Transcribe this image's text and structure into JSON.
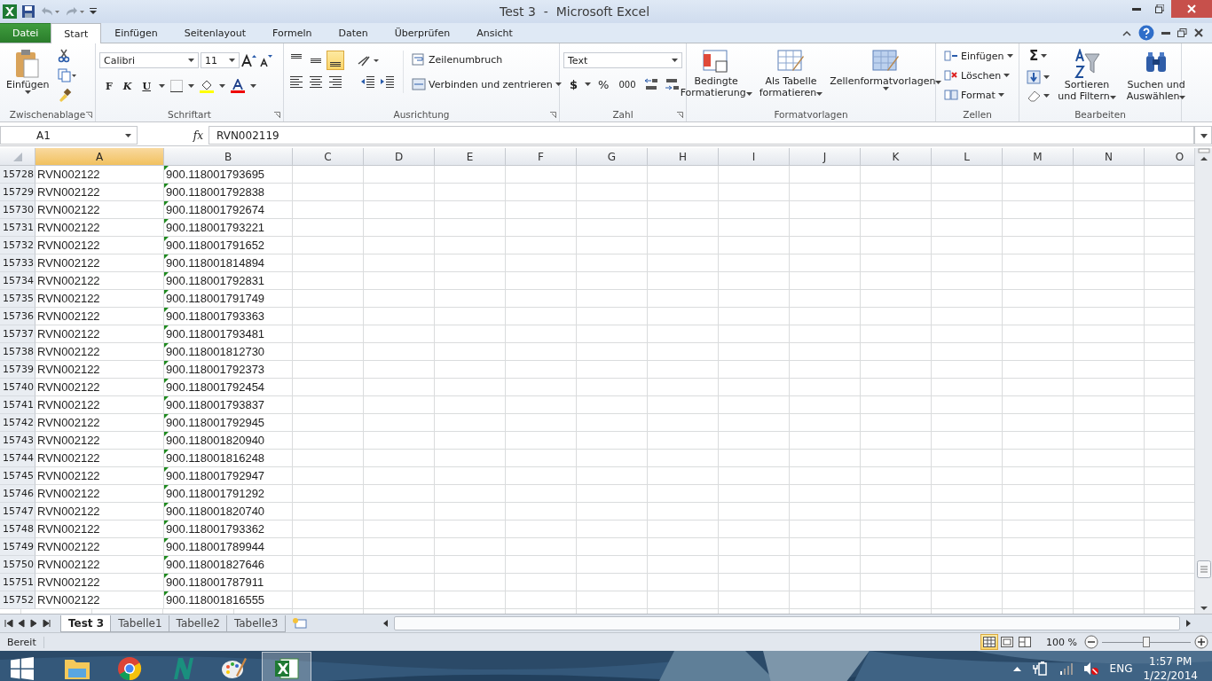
{
  "window": {
    "title": "Test 3  -  Microsoft Excel"
  },
  "tabs": [
    {
      "label": "Datei",
      "kind": "file",
      "selected": false
    },
    {
      "label": "Start",
      "kind": "tab",
      "selected": true
    },
    {
      "label": "Einfügen",
      "kind": "tab",
      "selected": false
    },
    {
      "label": "Seitenlayout",
      "kind": "tab",
      "selected": false
    },
    {
      "label": "Formeln",
      "kind": "tab",
      "selected": false
    },
    {
      "label": "Daten",
      "kind": "tab",
      "selected": false
    },
    {
      "label": "Überprüfen",
      "kind": "tab",
      "selected": false
    },
    {
      "label": "Ansicht",
      "kind": "tab",
      "selected": false
    }
  ],
  "ribbon": {
    "clipboard": {
      "label": "Zwischenablage",
      "paste": "Einfügen"
    },
    "font": {
      "label": "Schriftart",
      "name": "Calibri",
      "size": "11",
      "bold": "F",
      "italic": "K",
      "underline": "U"
    },
    "alignment": {
      "label": "Ausrichtung",
      "vertical": [
        {
          "selected": false
        },
        {
          "selected": false
        },
        {
          "selected": true
        }
      ],
      "wrap": "Zeilenumbruch",
      "merge": "Verbinden und zentrieren"
    },
    "number": {
      "label": "Zahl",
      "format": "Text",
      "currency": "$",
      "percent": "%",
      "thousands": "000"
    },
    "styles": {
      "label": "Formatvorlagen",
      "buttons": [
        {
          "lines": [
            "Bedingte",
            "Formatierung"
          ]
        },
        {
          "lines": [
            "Als Tabelle",
            "formatieren"
          ]
        },
        {
          "lines": [
            "Zellenformatvorlagen"
          ]
        }
      ]
    },
    "cells": {
      "label": "Zellen",
      "buttons": [
        "Einfügen",
        "Löschen",
        "Format"
      ]
    },
    "editing": {
      "label": "Bearbeiten",
      "sum": "Σ",
      "sort": [
        "Sortieren",
        "und Filtern"
      ],
      "find": [
        "Suchen und",
        "Auswählen"
      ]
    }
  },
  "formula_bar": {
    "name_box": "A1",
    "fx": "fx",
    "value": "RVN002119"
  },
  "columns": [
    {
      "name": "A",
      "selected": true
    },
    {
      "name": "B",
      "selected": false
    },
    {
      "name": "C",
      "selected": false
    },
    {
      "name": "D",
      "selected": false
    },
    {
      "name": "E",
      "selected": false
    },
    {
      "name": "F",
      "selected": false
    },
    {
      "name": "G",
      "selected": false
    },
    {
      "name": "H",
      "selected": false
    },
    {
      "name": "I",
      "selected": false
    },
    {
      "name": "J",
      "selected": false
    },
    {
      "name": "K",
      "selected": false
    },
    {
      "name": "L",
      "selected": false
    },
    {
      "name": "M",
      "selected": false
    },
    {
      "name": "N",
      "selected": false
    },
    {
      "name": "O",
      "selected": false
    }
  ],
  "rows": [
    {
      "number": "15728",
      "a": "RVN002122",
      "b": "900.118001793695",
      "flag": true
    },
    {
      "number": "15729",
      "a": "RVN002122",
      "b": "900.118001792838",
      "flag": true
    },
    {
      "number": "15730",
      "a": "RVN002122",
      "b": "900.118001792674",
      "flag": true
    },
    {
      "number": "15731",
      "a": "RVN002122",
      "b": "900.118001793221",
      "flag": true
    },
    {
      "number": "15732",
      "a": "RVN002122",
      "b": "900.118001791652",
      "flag": true
    },
    {
      "number": "15733",
      "a": "RVN002122",
      "b": "900.118001814894",
      "flag": true
    },
    {
      "number": "15734",
      "a": "RVN002122",
      "b": "900.118001792831",
      "flag": true
    },
    {
      "number": "15735",
      "a": "RVN002122",
      "b": "900.118001791749",
      "flag": true
    },
    {
      "number": "15736",
      "a": "RVN002122",
      "b": "900.118001793363",
      "flag": true
    },
    {
      "number": "15737",
      "a": "RVN002122",
      "b": "900.118001793481",
      "flag": true
    },
    {
      "number": "15738",
      "a": "RVN002122",
      "b": "900.118001812730",
      "flag": true
    },
    {
      "number": "15739",
      "a": "RVN002122",
      "b": "900.118001792373",
      "flag": true
    },
    {
      "number": "15740",
      "a": "RVN002122",
      "b": "900.118001792454",
      "flag": true
    },
    {
      "number": "15741",
      "a": "RVN002122",
      "b": "900.118001793837",
      "flag": true
    },
    {
      "number": "15742",
      "a": "RVN002122",
      "b": "900.118001792945",
      "flag": true
    },
    {
      "number": "15743",
      "a": "RVN002122",
      "b": "900.118001820940",
      "flag": true
    },
    {
      "number": "15744",
      "a": "RVN002122",
      "b": "900.118001816248",
      "flag": true
    },
    {
      "number": "15745",
      "a": "RVN002122",
      "b": "900.118001792947",
      "flag": true
    },
    {
      "number": "15746",
      "a": "RVN002122",
      "b": "900.118001791292",
      "flag": true
    },
    {
      "number": "15747",
      "a": "RVN002122",
      "b": "900.118001820740",
      "flag": true
    },
    {
      "number": "15748",
      "a": "RVN002122",
      "b": "900.118001793362",
      "flag": true
    },
    {
      "number": "15749",
      "a": "RVN002122",
      "b": "900.118001789944",
      "flag": true
    },
    {
      "number": "15750",
      "a": "RVN002122",
      "b": "900.118001827646",
      "flag": true
    },
    {
      "number": "15751",
      "a": "RVN002122",
      "b": "900.118001787911",
      "flag": true
    },
    {
      "number": "15752",
      "a": "RVN002122",
      "b": "900.118001816555",
      "flag": true
    }
  ],
  "sheet_tabs": [
    {
      "label": "Test 3",
      "selected": true
    },
    {
      "label": "Tabelle1",
      "selected": false
    },
    {
      "label": "Tabelle2",
      "selected": false
    },
    {
      "label": "Tabelle3",
      "selected": false
    }
  ],
  "status_bar": {
    "status": "Bereit",
    "views": [
      {
        "selected": true
      },
      {
        "selected": false
      },
      {
        "selected": false
      }
    ],
    "zoom": "100 %",
    "zoom_slider": {
      "level": 0.5
    }
  },
  "taskbar": {
    "apps": [
      {
        "kind": "explorer",
        "selected": false
      },
      {
        "kind": "chrome",
        "selected": false
      },
      {
        "kind": "n-app",
        "selected": false
      },
      {
        "kind": "paint",
        "selected": false
      },
      {
        "kind": "excel",
        "selected": true
      }
    ],
    "language": "ENG",
    "time": "1:57 PM",
    "date": "1/22/2014"
  }
}
